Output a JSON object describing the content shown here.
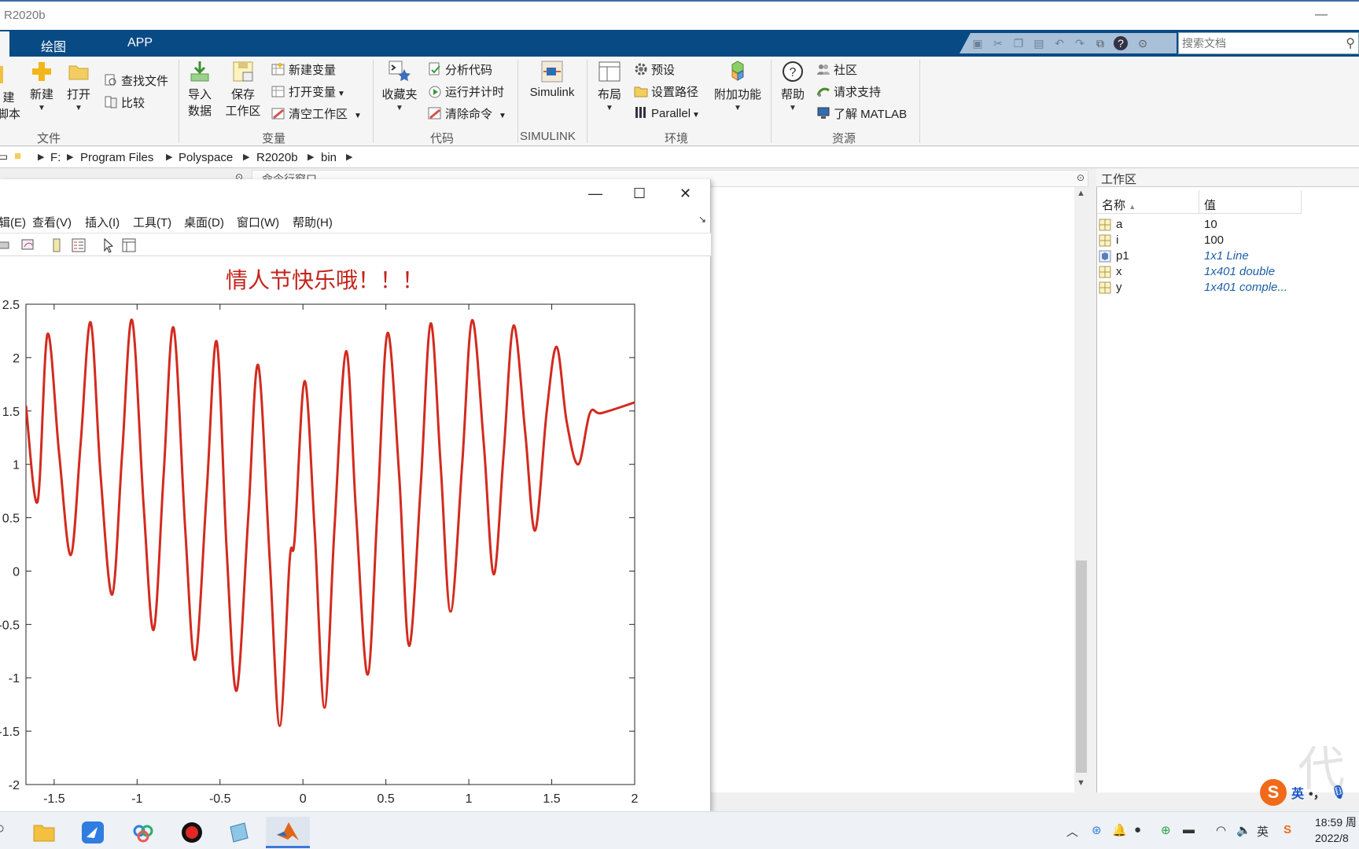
{
  "window": {
    "title": "R2020b",
    "minimize_glyph": "—"
  },
  "ribbon": {
    "tabs": [
      "绘图",
      "APP"
    ],
    "search_placeholder": "搜索文档",
    "groups": {
      "file": {
        "label": "文件",
        "new_script_partial_1": "建",
        "new_script_partial_2": "脚本",
        "new": "新建",
        "open": "打开",
        "find_files": "查找文件",
        "compare": "比较"
      },
      "variable": {
        "label": "变量",
        "import_1": "导入",
        "import_2": "数据",
        "save_1": "保存",
        "save_2": "工作区",
        "new_var": "新建变量",
        "open_var": "打开变量",
        "clear_ws": "清空工作区"
      },
      "code": {
        "label": "代码",
        "favorites": "收藏夹",
        "analyze": "分析代码",
        "run_time": "运行并计时",
        "clear_cmd": "清除命令"
      },
      "simulink": {
        "label": "SIMULINK",
        "simulink": "Simulink"
      },
      "environment": {
        "label": "环境",
        "layout": "布局",
        "prefs": "预设",
        "set_path": "设置路径",
        "parallel": "Parallel",
        "addons": "附加功能"
      },
      "resources": {
        "label": "资源",
        "help": "帮助",
        "community": "社区",
        "support": "请求支持",
        "learn": "了解 MATLAB"
      }
    }
  },
  "address": [
    "F:",
    "Program Files",
    "Polyspace",
    "R2020b",
    "bin"
  ],
  "command_window": {
    "title": "命令行窗口"
  },
  "workspace": {
    "title": "工作区",
    "col_name": "名称",
    "col_value": "值",
    "rows": [
      {
        "name": "a",
        "value": "10",
        "kind": "matrix"
      },
      {
        "name": "i",
        "value": "100",
        "kind": "matrix"
      },
      {
        "name": "p1",
        "value": "1x1 Line",
        "kind": "object"
      },
      {
        "name": "x",
        "value": "1x401 double",
        "kind": "matrix"
      },
      {
        "name": "y",
        "value": "1x401 comple...",
        "kind": "matrix"
      }
    ],
    "watermark": "代"
  },
  "figure": {
    "menus": [
      "辑(E)",
      "查看(V)",
      "插入(I)",
      "工具(T)",
      "桌面(D)",
      "窗口(W)",
      "帮助(H)"
    ],
    "controls": {
      "minimize": "—",
      "maximize": "☐",
      "close": "✕"
    }
  },
  "chart_data": {
    "type": "line",
    "title": "情人节快乐哦！！！",
    "xlabel": "",
    "ylabel": "",
    "xlim": [
      -1.67,
      2.0
    ],
    "ylim": [
      -2.0,
      2.5
    ],
    "x_ticks": [
      "-1.5",
      "-1",
      "-0.5",
      "0",
      "0.5",
      "1",
      "1.5",
      "2"
    ],
    "y_ticks": [
      "-2",
      "-1.5",
      "-1",
      "-0.5",
      "0",
      "0.5",
      "1",
      "1.5",
      "2",
      "2.5"
    ],
    "y_tick_values": [
      -2,
      -1.5,
      -1,
      -0.5,
      0,
      0.5,
      1,
      1.5,
      2,
      2.5
    ],
    "x_tick_values": [
      -1.5,
      -1,
      -0.5,
      0,
      0.5,
      1,
      1.5,
      2
    ],
    "line_color": "#d22b1f",
    "series": [
      {
        "x": [
          -1.67,
          -1.6,
          -1.54,
          -1.47,
          -1.4,
          -1.34,
          -1.28,
          -1.22,
          -1.15,
          -1.09,
          -1.03,
          -0.96,
          -0.9,
          -0.84,
          -0.78,
          -0.71,
          -0.65,
          -0.58,
          -0.52,
          -0.46,
          -0.4,
          -0.33,
          -0.27,
          -0.2,
          -0.14,
          -0.08,
          -0.05,
          0.01,
          0.07,
          0.13,
          0.19,
          0.26,
          0.32,
          0.39,
          0.45,
          0.51,
          0.58,
          0.64,
          0.71,
          0.77,
          0.83,
          0.89,
          0.96,
          1.02,
          1.09,
          1.15,
          1.21,
          1.27,
          1.34,
          1.4,
          1.47,
          1.53,
          1.59,
          1.66,
          1.73,
          1.8,
          2.0
        ],
        "y": [
          1.55,
          0.65,
          2.22,
          1.1,
          0.15,
          1.2,
          2.33,
          0.9,
          -0.22,
          1.1,
          2.35,
          0.6,
          -0.55,
          0.9,
          2.28,
          0.4,
          -0.83,
          0.75,
          2.15,
          0.2,
          -1.12,
          0.5,
          1.93,
          0.1,
          -1.45,
          0.1,
          0.3,
          1.78,
          0.4,
          -1.28,
          0.4,
          2.06,
          0.55,
          -0.97,
          0.6,
          2.23,
          0.9,
          -0.7,
          0.8,
          2.32,
          1.0,
          -0.38,
          1.0,
          2.35,
          1.2,
          -0.03,
          1.1,
          2.3,
          1.3,
          0.38,
          1.5,
          2.1,
          1.4,
          1.0,
          1.48,
          1.48,
          1.58
        ]
      }
    ]
  },
  "taskbar": {
    "clock_time": "18:59 周",
    "clock_date": "2022/8",
    "ime_lang": "英",
    "ime_punct": "•，",
    "tray_lang": "英"
  }
}
